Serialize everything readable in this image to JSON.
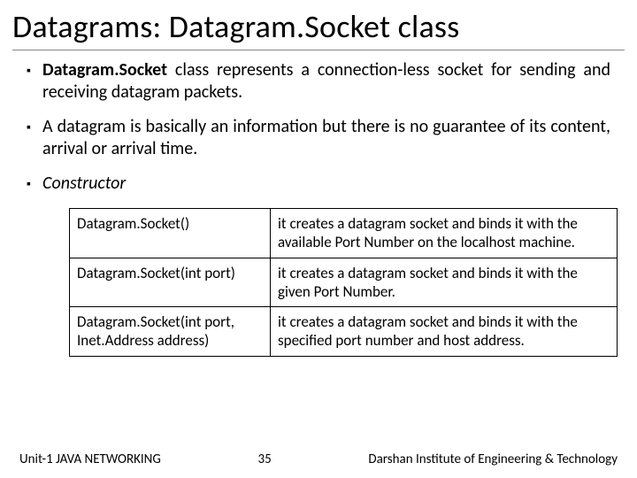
{
  "title": "Datagrams: Datagram.Socket class",
  "bullets": {
    "b1_bold": "Datagram.Socket",
    "b1_rest": " class represents a connection-less socket for sending and receiving datagram packets.",
    "b2": "A datagram is basically an information but there is no guarantee of its content, arrival or arrival time.",
    "b3": "Constructor"
  },
  "table": {
    "r1c1": "Datagram.Socket()",
    "r1c2": "it creates a datagram socket and binds it with the available Port Number on the localhost machine.",
    "r2c1": "Datagram.Socket(int port)",
    "r2c2": "it creates a datagram socket and binds it with the given Port Number.",
    "r3c1": "Datagram.Socket(int port, Inet.Address address)",
    "r3c2": "it creates a datagram socket and binds it with the specified port number and host address."
  },
  "footer": {
    "left": "Unit-1 JAVA NETWORKING",
    "page": "35",
    "right": "Darshan Institute of Engineering & Technology"
  }
}
